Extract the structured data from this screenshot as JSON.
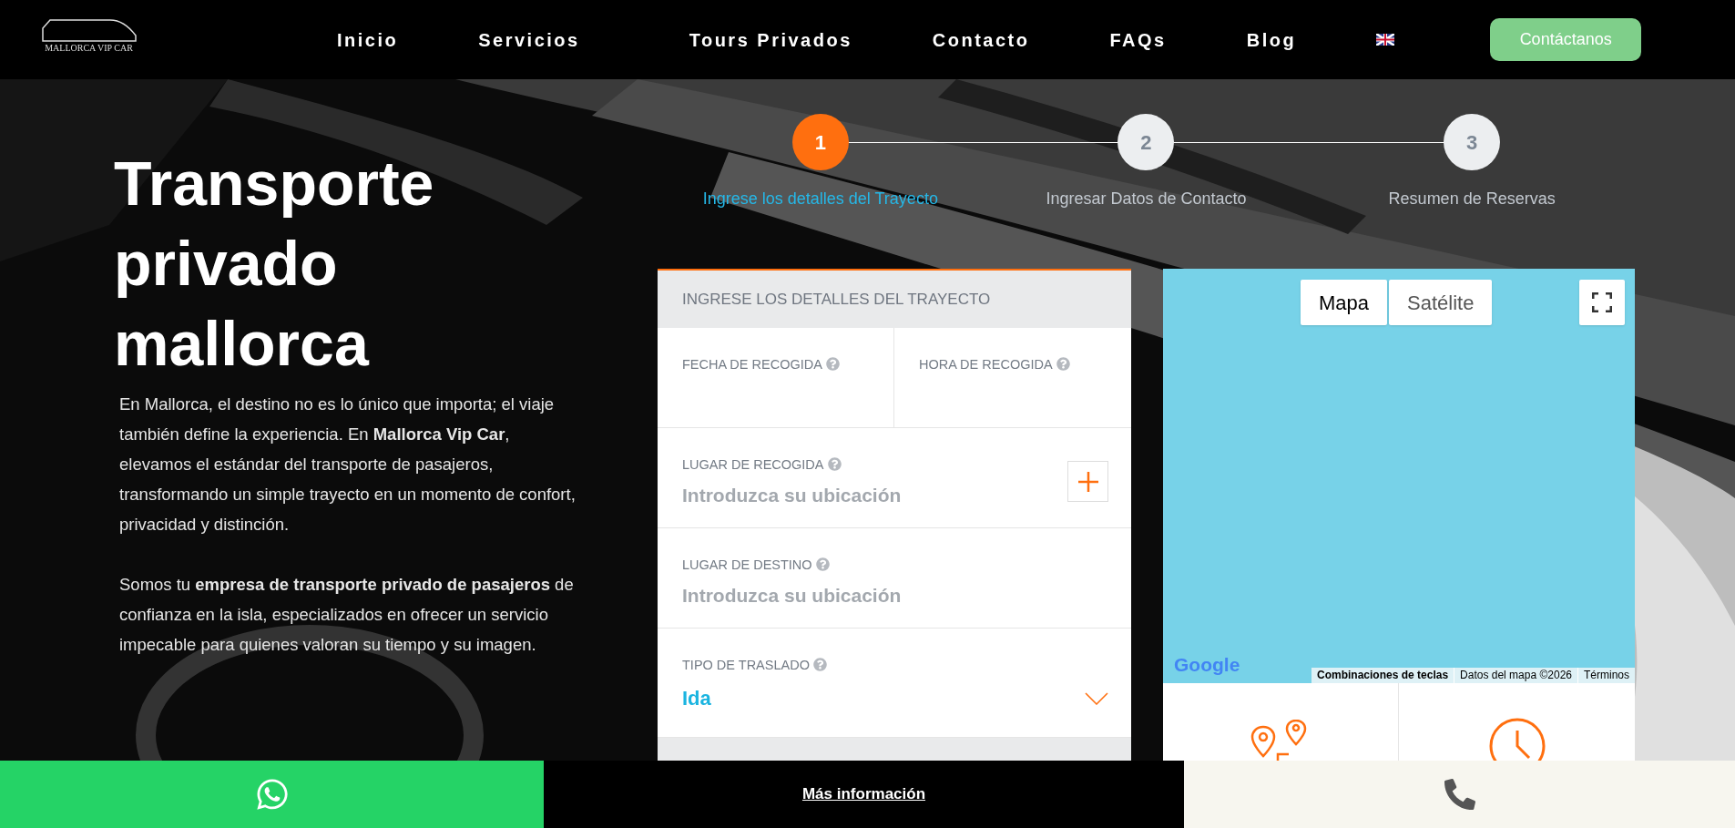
{
  "header": {
    "logo_text": "MALLORCA VIP CAR",
    "nav": [
      {
        "label": "Inicio"
      },
      {
        "label": "Servicios"
      },
      {
        "label": "Tours Privados"
      },
      {
        "label": "Contacto"
      },
      {
        "label": "FAQs"
      },
      {
        "label": "Blog"
      }
    ],
    "cta": "Contáctanos"
  },
  "hero": {
    "title": "Transporte privado mallorca",
    "paragraphs": [
      "En Mallorca, el destino no es lo único que importa; el viaje también define la experiencia. En **Mallorca Vip Car**, elevamos el estándar del transporte de pasajeros, transformando un simple trayecto en un momento de confort, privacidad y distinción.",
      "Somos tu **empresa de transporte privado de pasajeros** de confianza en la isla, especializados en ofrecer un servicio impecable para quienes valoran su tiempo y su imagen."
    ]
  },
  "steps": [
    {
      "number": "1",
      "label": "Ingrese los detalles del Trayecto",
      "selected": true
    },
    {
      "number": "2",
      "label": "Ingresar Datos de Contacto",
      "selected": false
    },
    {
      "number": "3",
      "label": "Resumen de Reservas",
      "selected": false
    }
  ],
  "form": {
    "title": "INGRESE LOS DETALLES DEL TRAYECTO",
    "pair": [
      {
        "label": "FECHA DE RECOGIDA"
      },
      {
        "label": "HORA DE RECOGIDA"
      }
    ],
    "fields": [
      {
        "kind": "location",
        "label": "LUGAR DE RECOGIDA",
        "placeholder": "Introduzca su ubicación",
        "add_button": true
      },
      {
        "kind": "location",
        "label": "LUGAR DE DESTINO",
        "placeholder": "Introduzca su ubicación"
      },
      {
        "kind": "select",
        "label": "TIPO DE TRASLADO",
        "value": "Ida"
      }
    ]
  },
  "map": {
    "map_types": [
      {
        "label": "Mapa",
        "selected": true
      },
      {
        "label": "Satélite",
        "selected": false
      }
    ],
    "logo": "Google",
    "attribution": [
      "Combinaciones de teclas",
      "Datos del mapa ©2026",
      "Términos"
    ]
  },
  "bottom_bar": {
    "link": "Más información"
  }
}
